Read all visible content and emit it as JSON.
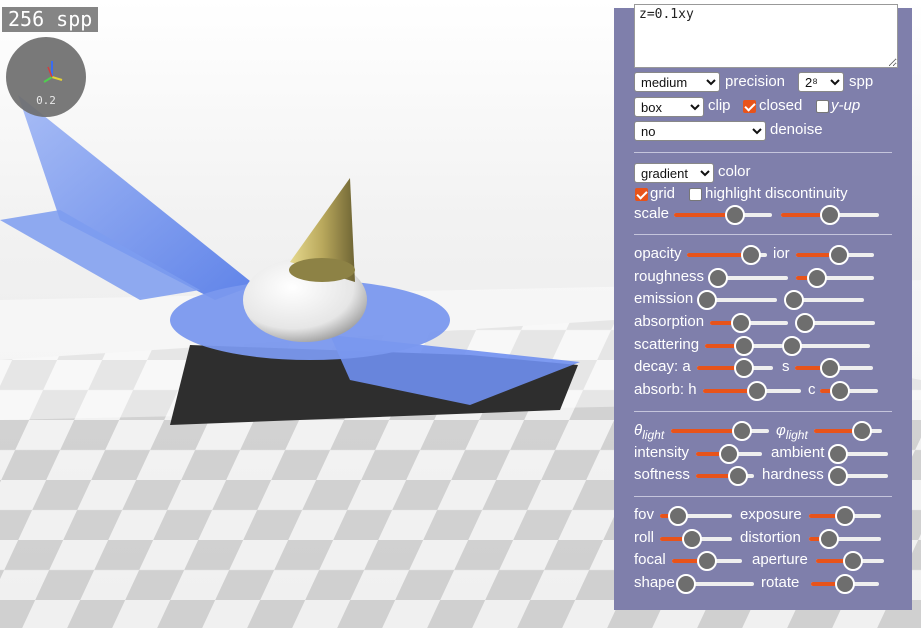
{
  "viewport": {
    "spp_counter": "256 spp",
    "gizmo_scale": "0.2"
  },
  "panel": {
    "equation_text": "z=0.1xy",
    "precision": {
      "value": "medium",
      "label": "precision"
    },
    "spp": {
      "value": "2⁸",
      "label": "spp"
    },
    "clip": {
      "value": "box",
      "label": "clip"
    },
    "closed": {
      "label": "closed",
      "checked": true
    },
    "yup": {
      "label": "y-up",
      "checked": false
    },
    "denoise": {
      "value": "no",
      "label": "denoise"
    },
    "color": {
      "value": "gradient",
      "label": "color"
    },
    "grid": {
      "label": "grid",
      "checked": true
    },
    "highlight": {
      "label": "highlight discontinuity",
      "checked": false
    },
    "labels": {
      "scale": "scale",
      "opacity": "opacity",
      "ior": "ior",
      "roughness": "roughness",
      "emission": "emission",
      "absorption": "absorption",
      "scattering": "scattering",
      "decay_a": "decay: a",
      "decay_s": "s",
      "absorb_h": "absorb: h",
      "absorb_c": "c",
      "theta_light": "θ",
      "theta_sub": "light",
      "phi_light": "φ",
      "phi_sub": "light",
      "intensity": "intensity",
      "ambient": "ambient",
      "softness": "softness",
      "hardness": "hardness",
      "fov": "fov",
      "exposure": "exposure",
      "roll": "roll",
      "distortion": "distortion",
      "focal": "focal",
      "aperture": "aperture",
      "shape": "shape",
      "rotate": "rotate"
    },
    "slider_values": {
      "scale_1": 0.62,
      "scale_2": 0.5,
      "opacity": 0.8,
      "ior": 0.55,
      "roughness": 0.0,
      "roughness_2": 0.27,
      "emission": 0.0,
      "emission_2": 0.0,
      "absorption": 0.4,
      "absorption_2": 0.1,
      "scattering": 0.5,
      "scattering_2": 0.0,
      "decay_a": 0.62,
      "decay_s": 0.45,
      "absorb_h": 0.55,
      "absorb_c": 0.35,
      "theta_light": 0.72,
      "phi_light": 0.7,
      "intensity": 0.5,
      "ambient": 0.0,
      "softness": 0.72,
      "hardness": 0.0,
      "fov": 0.25,
      "exposure": 0.5,
      "roll": 0.45,
      "distortion": 0.28,
      "focal": 0.5,
      "aperture": 0.55,
      "shape": 0.0,
      "rotate": 0.5
    }
  }
}
